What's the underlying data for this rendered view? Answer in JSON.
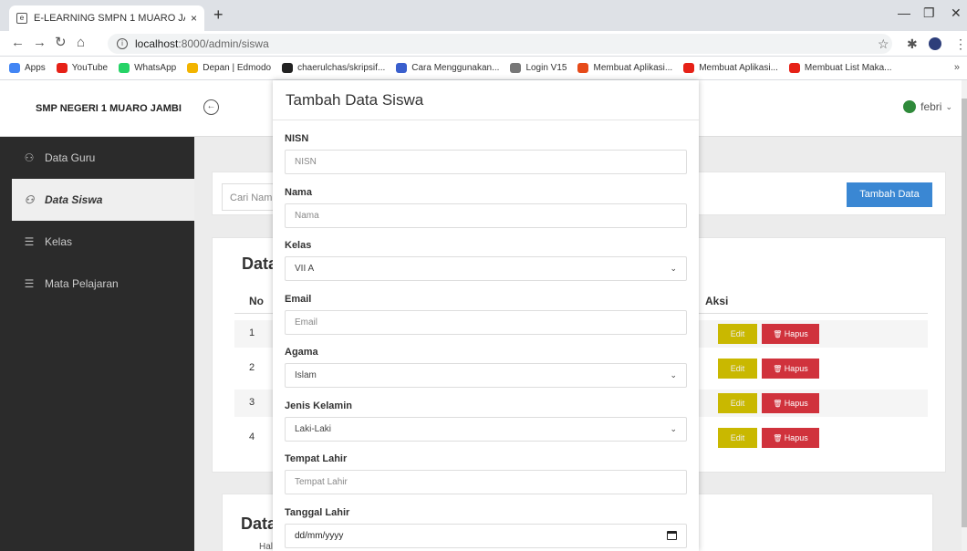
{
  "browser": {
    "tab_title": "E-LEARNING SMPN 1 MUARO JA",
    "tab_close": "×",
    "new_tab": "+",
    "url_host": "localhost",
    "url_path": ":8000/admin/siswa",
    "bookmarks": [
      {
        "label": "Apps",
        "color": "#4285f4"
      },
      {
        "label": "YouTube",
        "color": "#e62117"
      },
      {
        "label": "WhatsApp",
        "color": "#25d366"
      },
      {
        "label": "Depan | Edmodo",
        "color": "#f2b400"
      },
      {
        "label": "chaerulchas/skripsif...",
        "color": "#222222"
      },
      {
        "label": "Cara Menggunakan...",
        "color": "#3a5fcd"
      },
      {
        "label": "Login V15",
        "color": "#777777"
      },
      {
        "label": "Membuat Aplikasi...",
        "color": "#e64a19"
      },
      {
        "label": "Membuat Aplikasi...",
        "color": "#e62117"
      },
      {
        "label": "Membuat List Maka...",
        "color": "#e62117"
      }
    ],
    "bookmarks_more": "»"
  },
  "app": {
    "brand": "SMP NEGERI 1 MUARO JAMBI",
    "user": "febri",
    "sidebar": [
      {
        "label": "Data Guru",
        "icon": "users-icon"
      },
      {
        "label": "Data Siswa",
        "icon": "users-icon",
        "active": true
      },
      {
        "label": "Kelas",
        "icon": "database-icon"
      },
      {
        "label": "Mata Pelajaran",
        "icon": "database-icon"
      }
    ],
    "search_placeholder": "Cari Nama",
    "add_button": "Tambah Data",
    "table_title": "Data",
    "table_header_no": "No",
    "table_header_action": "Aksi",
    "rows": [
      "1",
      "2",
      "3",
      "4"
    ],
    "edit_label": "Edit",
    "delete_label": "Hapus",
    "second_card_title": "Data",
    "second_card_sub": "Hal"
  },
  "modal": {
    "title": "Tambah Data Siswa",
    "fields": [
      {
        "label": "NISN",
        "placeholder": "NISN"
      },
      {
        "label": "Nama",
        "placeholder": "Nama"
      },
      {
        "label": "Kelas",
        "value": "VII A"
      },
      {
        "label": "Email",
        "placeholder": "Email"
      },
      {
        "label": "Agama",
        "value": "Islam"
      },
      {
        "label": "Jenis Kelamin",
        "value": "Laki-Laki"
      },
      {
        "label": "Tempat Lahir",
        "placeholder": "Tempat Lahir"
      },
      {
        "label": "Tanggal Lahir",
        "value": "dd/mm/yyyy"
      }
    ]
  }
}
